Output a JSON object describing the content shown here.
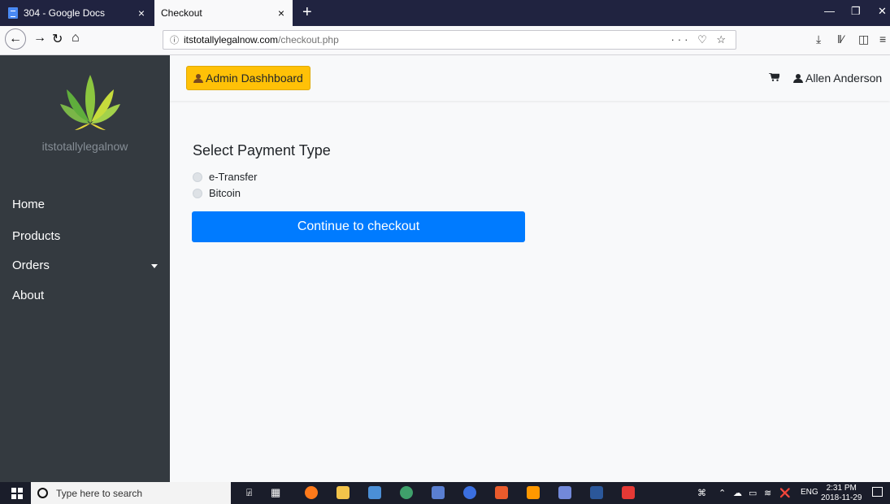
{
  "browser": {
    "tabs": [
      {
        "title": "304 - Google Docs",
        "active": false
      },
      {
        "title": "Checkout",
        "active": true
      }
    ],
    "close_glyph": "×",
    "new_tab_glyph": "+",
    "url": {
      "domain": "itstotallylegalnow.com",
      "path": "/checkout.php"
    },
    "url_actions": "··· ♡ ☆"
  },
  "sidebar": {
    "brand": "itstotallylegalnow",
    "items": [
      {
        "label": "Home"
      },
      {
        "label": "Products"
      },
      {
        "label": "Orders",
        "has_dropdown": true
      },
      {
        "label": "About"
      }
    ]
  },
  "header": {
    "admin_button": "Admin Dashhboard",
    "user_name": "Allen Anderson",
    "cart_icon": "cart-icon",
    "accent": "#ffc107"
  },
  "main": {
    "title": "Select Payment Type",
    "payment_options": [
      {
        "label": "e-Transfer",
        "checked": false
      },
      {
        "label": "Bitcoin",
        "checked": false
      }
    ],
    "checkout_button": "Continue to checkout",
    "button_color": "#007bff"
  },
  "taskbar": {
    "search_placeholder": "Type here to search",
    "language": "ENG",
    "time": "2:31 PM",
    "date": "2018-11-29"
  }
}
